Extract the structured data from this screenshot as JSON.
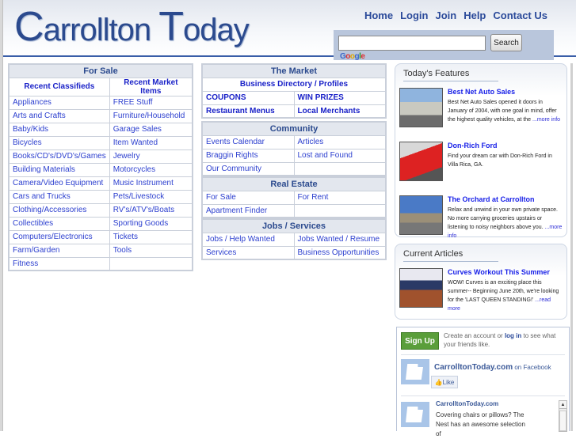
{
  "header": {
    "logo": {
      "cap1": "C",
      "rest1": "arrollton ",
      "cap2": "T",
      "rest2": "oday"
    },
    "nav": [
      "Home",
      "Login",
      "Join",
      "Help",
      "Contact Us"
    ],
    "search": {
      "value": "",
      "placeholder": "",
      "button": "Search",
      "provider": "Google",
      "provider_letters": [
        "G",
        "o",
        "o",
        "g",
        "l",
        "e"
      ]
    }
  },
  "for_sale": {
    "title": "For Sale",
    "subheads": [
      "Recent Classifieds",
      "Recent Market Items"
    ],
    "rows": [
      [
        "Appliances",
        "FREE Stuff"
      ],
      [
        "Arts and Crafts",
        "Furniture/Household"
      ],
      [
        "Baby/Kids",
        "Garage Sales"
      ],
      [
        "Bicycles",
        "Item Wanted"
      ],
      [
        "Books/CD's/DVD's/Games",
        "Jewelry"
      ],
      [
        "Building Materials",
        "Motorcycles"
      ],
      [
        "Camera/Video Equipment",
        "Music Instrument"
      ],
      [
        "Cars and Trucks",
        "Pets/Livestock"
      ],
      [
        "Clothing/Accessories",
        "RV's/ATV's/Boats"
      ],
      [
        "Collectibles",
        "Sporting Goods"
      ],
      [
        "Computers/Electronics",
        "Tickets"
      ],
      [
        "Farm/Garden",
        "Tools"
      ],
      [
        "Fitness",
        ""
      ]
    ]
  },
  "market": {
    "title": "The Market",
    "featured": "Business Directory / Profiles",
    "rows": [
      [
        "COUPONS",
        "WIN PRIZES"
      ],
      [
        "Restaurant Menus",
        "Local Merchants"
      ]
    ]
  },
  "community": {
    "title": "Community",
    "rows": [
      [
        "Events Calendar",
        "Articles"
      ],
      [
        "Braggin Rights",
        "Lost and Found"
      ],
      [
        "Our Community",
        ""
      ]
    ]
  },
  "real_estate": {
    "title": "Real Estate",
    "rows": [
      [
        "For Sale",
        "For Rent"
      ],
      [
        "Apartment Finder",
        ""
      ]
    ]
  },
  "jobs": {
    "title": "Jobs / Services",
    "rows": [
      [
        "Jobs / Help Wanted",
        "Jobs Wanted / Resume"
      ],
      [
        "Services",
        "Business Opportunities"
      ]
    ]
  },
  "features": {
    "title": "Today's Features",
    "items": [
      {
        "title": "Best Net Auto Sales",
        "desc": "Best Net Auto Sales opened it doors in January of 2004, with one goal in mind, offer the highest quality vehicles, at the ",
        "more": "...more info"
      },
      {
        "title": "Don-Rich Ford",
        "desc": "Find your dream car with Don-Rich Ford in Villa Rica, GA.",
        "more": ""
      },
      {
        "title": "The Orchard at Carrollton",
        "desc": "Relax and unwind in your own private space. No more carrying groceries upstairs or listening to noisy neighbors above you. ",
        "more": "...more info"
      }
    ]
  },
  "articles": {
    "title": "Current Articles",
    "items": [
      {
        "title": "Curves Workout This Summer",
        "desc": "WOW! Curves is an exciting place this summer-- Beginning June 20th, we're looking for the 'LAST QUEEN STANDING!' ",
        "more": "...read more"
      }
    ]
  },
  "facebook": {
    "signup": "Sign Up",
    "text_before": "Create an account or ",
    "login": "log in",
    "text_after": " to see what your friends like.",
    "page_name": "CarrolltonToday.com",
    "on_facebook": " on Facebook",
    "like": "Like",
    "post_author": "CarrolltonToday.com",
    "post_text": "Covering chairs or pillows? The Nest has an awesome selection of"
  }
}
